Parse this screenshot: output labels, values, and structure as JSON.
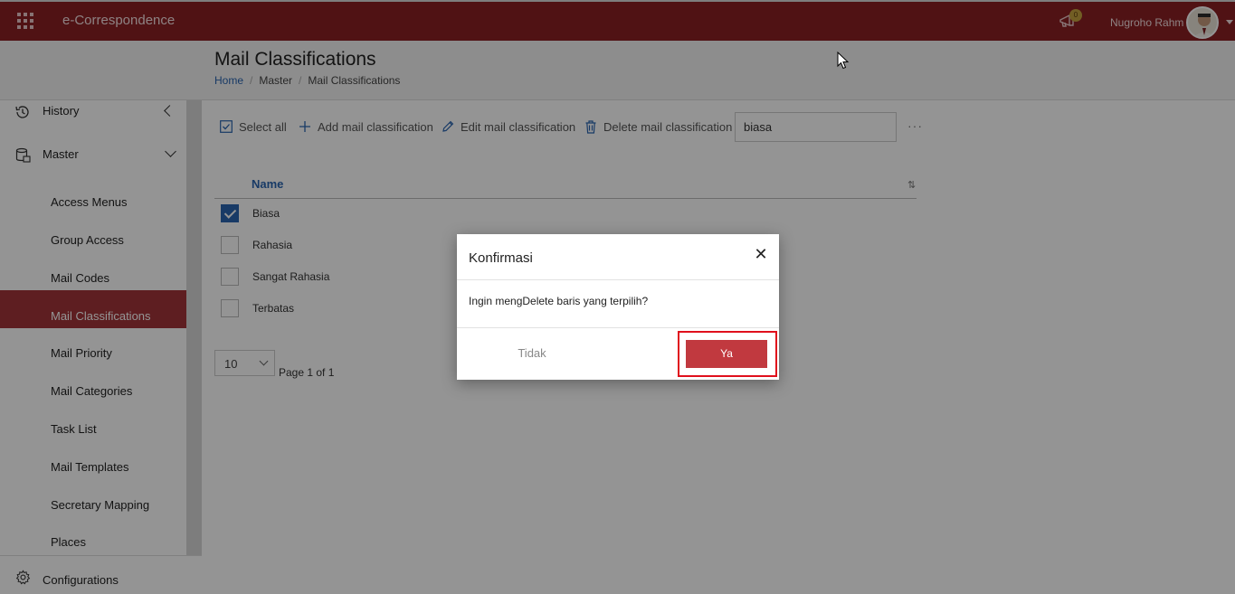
{
  "header": {
    "app_title": "e-Correspondence",
    "notification_count": "0",
    "user_name": "Nugroho Rahm"
  },
  "page": {
    "title": "Mail Classifications",
    "breadcrumb": [
      "Home",
      "Master",
      "Mail Classifications"
    ]
  },
  "sidebar": {
    "history": "History",
    "master": "Master",
    "items": [
      {
        "label": "Access Menus"
      },
      {
        "label": "Group Access"
      },
      {
        "label": "Mail Codes"
      },
      {
        "label": "Mail Classifications",
        "active": true
      },
      {
        "label": "Mail Priority"
      },
      {
        "label": "Mail Categories"
      },
      {
        "label": "Task List"
      },
      {
        "label": "Mail Templates"
      },
      {
        "label": "Secretary Mapping"
      },
      {
        "label": "Places"
      }
    ],
    "configurations": "Configurations"
  },
  "toolbar": {
    "select_all": "Select all",
    "add": "Add mail classification",
    "edit": "Edit mail classification",
    "delete": "Delete mail classification",
    "search_value": "biasa",
    "more": "···"
  },
  "table": {
    "column_name": "Name",
    "rows": [
      {
        "name": "Biasa",
        "checked": true
      },
      {
        "name": "Rahasia",
        "checked": false
      },
      {
        "name": "Sangat Rahasia",
        "checked": false
      },
      {
        "name": "Terbatas",
        "checked": false
      }
    ]
  },
  "pager": {
    "page_size": "10",
    "page_text": "Page 1 of 1"
  },
  "dialog": {
    "title": "Konfirmasi",
    "message": "Ingin mengDelete baris yang terpilih?",
    "no_label": "Tidak",
    "yes_label": "Ya"
  },
  "colors": {
    "brand": "#8a1f24",
    "active_item": "#a3353a",
    "link": "#2a65b0",
    "confirm_button": "#c1393f",
    "highlight_box": "#e0101c"
  }
}
